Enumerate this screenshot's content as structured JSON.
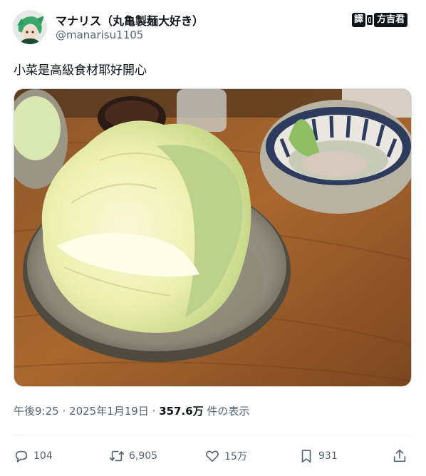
{
  "author": {
    "display_name": "マナリス（丸亀製麺大好き）",
    "handle": "@manarisu1105"
  },
  "watermark": {
    "left": "譯",
    "right": "方吉君"
  },
  "tweet": {
    "text": "小菜是高級食材耶好開心"
  },
  "meta": {
    "time": "午後9:25",
    "sep1": "·",
    "date": "2025年1月19日",
    "sep2": "·",
    "views": "357.6万",
    "views_label": "件の表示"
  },
  "actions": {
    "replies": "104",
    "reposts": "6,905",
    "likes": "15万",
    "bookmarks": "931"
  },
  "icons": [
    "avatar",
    "reply-icon",
    "repost-icon",
    "like-icon",
    "bookmark-icon",
    "share-icon"
  ]
}
